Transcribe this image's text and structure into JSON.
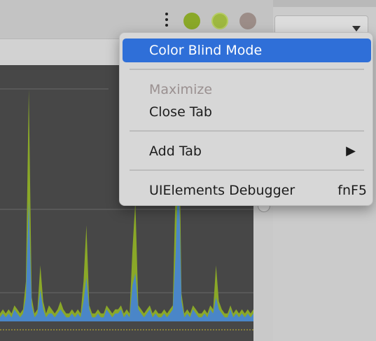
{
  "window": {
    "menu_icon": "kebab-menu-icon",
    "controls": [
      {
        "name": "green-button",
        "color": "#8aa828"
      },
      {
        "name": "green-button-hover",
        "color": "#9eb840"
      },
      {
        "name": "gray-button",
        "color": "#9c8d88"
      }
    ]
  },
  "context_menu": {
    "items": [
      {
        "label": "Color Blind Mode",
        "highlighted": true
      },
      {
        "label": "Maximize",
        "disabled": true
      },
      {
        "label": "Close Tab"
      },
      {
        "label": "Add Tab",
        "submenu_icon": "▶"
      },
      {
        "label": "UIElements Debugger",
        "shortcut": "fnF5"
      }
    ]
  },
  "colors": {
    "menu_highlight": "#2f6fd8",
    "series_green": "#8aa828",
    "series_blue": "#4a86c8",
    "chart_background": "#474747"
  },
  "chart_data": {
    "type": "area",
    "series": [
      {
        "values": [
          2,
          3,
          2,
          3,
          2,
          4,
          3,
          2,
          3,
          10,
          58,
          6,
          2,
          3,
          14,
          5,
          2,
          4,
          3,
          2,
          3,
          5,
          3,
          2,
          2,
          3,
          2,
          3,
          2,
          10,
          24,
          4,
          2,
          2,
          3,
          2,
          2,
          4,
          3,
          2,
          3,
          3,
          4,
          2,
          3,
          2,
          18,
          30,
          4,
          3,
          2,
          3,
          4,
          2,
          3,
          2,
          2,
          3,
          2,
          3,
          4,
          34,
          62,
          7,
          2,
          3,
          2,
          4,
          3,
          2,
          2,
          3,
          2,
          4,
          3,
          14,
          5,
          3,
          2,
          2,
          4,
          2,
          3,
          2,
          3,
          2,
          3,
          2,
          3
        ]
      },
      {
        "values": [
          1,
          2,
          1,
          2,
          1,
          3,
          2,
          1,
          2,
          6,
          30,
          4,
          1,
          2,
          8,
          3,
          1,
          2,
          2,
          1,
          2,
          3,
          2,
          1,
          1,
          2,
          1,
          2,
          1,
          5,
          11,
          3,
          1,
          1,
          2,
          1,
          1,
          3,
          2,
          1,
          2,
          2,
          3,
          1,
          2,
          1,
          9,
          12,
          3,
          2,
          1,
          2,
          3,
          1,
          2,
          1,
          1,
          2,
          1,
          2,
          3,
          17,
          40,
          5,
          1,
          2,
          1,
          3,
          2,
          1,
          1,
          2,
          1,
          3,
          2,
          6,
          3,
          2,
          1,
          1,
          3,
          1,
          2,
          1,
          2,
          1,
          2,
          1,
          2
        ]
      }
    ]
  }
}
